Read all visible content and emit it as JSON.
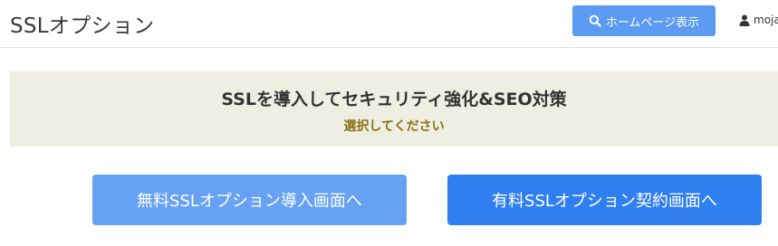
{
  "header": {
    "title": "SSLオプション",
    "home_button": {
      "label": "ホームページ表示",
      "icon": "search-icon"
    },
    "user": {
      "name": "moja",
      "icon": "user-icon"
    }
  },
  "banner": {
    "title": "SSLを導入してセキュリティ強化&SEO対策",
    "subtitle": "選択してください"
  },
  "options": {
    "free_label": "無料SSLオプション導入画面へ",
    "paid_label": "有料SSLオプション契約画面へ"
  },
  "colors": {
    "home_button": "#5b9bf1",
    "banner_bg": "#efeee2",
    "subtitle_text": "#8a7216",
    "free_button": "#66a1f3",
    "paid_button": "#2f7ff1"
  }
}
